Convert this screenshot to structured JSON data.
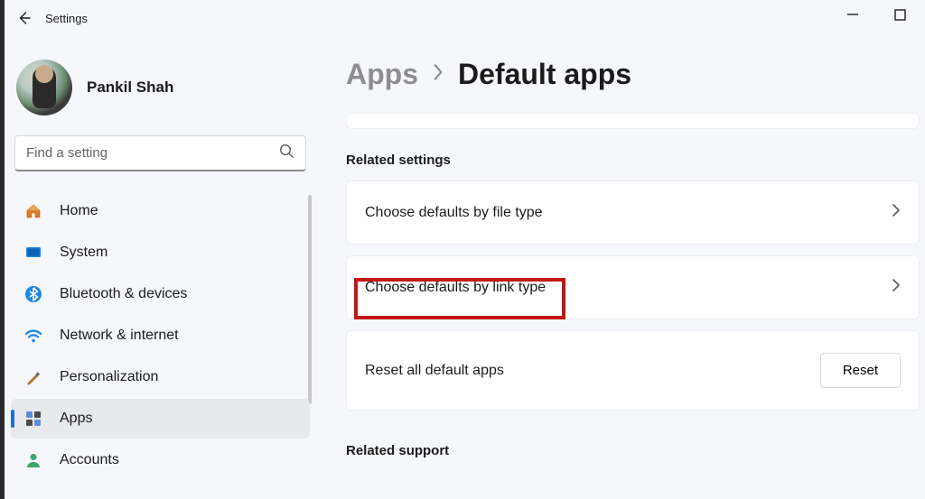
{
  "window": {
    "title": "Settings",
    "user_name": "Pankil Shah"
  },
  "search": {
    "placeholder": "Find a setting"
  },
  "sidebar": {
    "items": [
      {
        "label": "Home",
        "icon": "home-icon"
      },
      {
        "label": "System",
        "icon": "system-icon"
      },
      {
        "label": "Bluetooth & devices",
        "icon": "bluetooth-icon"
      },
      {
        "label": "Network & internet",
        "icon": "network-icon"
      },
      {
        "label": "Personalization",
        "icon": "personalization-icon"
      },
      {
        "label": "Apps",
        "icon": "apps-icon"
      },
      {
        "label": "Accounts",
        "icon": "accounts-icon"
      }
    ],
    "active_index": 5
  },
  "breadcrumb": {
    "parent": "Apps",
    "current": "Default apps"
  },
  "sections": {
    "related_settings_heading": "Related settings",
    "related_support_heading": "Related support",
    "items": {
      "file_type": "Choose defaults by file type",
      "link_type": "Choose defaults by link type",
      "reset_label": "Reset all default apps",
      "reset_button": "Reset"
    }
  }
}
